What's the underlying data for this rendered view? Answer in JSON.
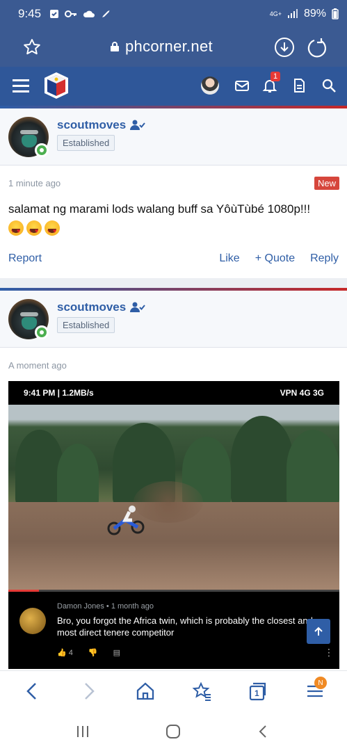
{
  "status": {
    "time": "9:45",
    "network": "4G+",
    "battery": "89%"
  },
  "browser": {
    "url": "phcorner.net"
  },
  "nav": {
    "notification_count": "1"
  },
  "posts": [
    {
      "username": "scoutmoves",
      "user_title": "Established",
      "time": "1 minute ago",
      "badge": "New",
      "message": "salamat ng marami lods walang buff sa YôùTùbé 1080p!!!",
      "actions": {
        "report": "Report",
        "like": "Like",
        "quote": "Quote",
        "reply": "Reply"
      }
    },
    {
      "username": "scoutmoves",
      "user_title": "Established",
      "time": "A moment ago"
    }
  ],
  "screenshot": {
    "status_left": "9:41 PM | 1.2MB/s",
    "status_right": "VPN 4G 3G",
    "comment_author": "Damon Jones",
    "comment_time": "1 month ago",
    "comment_text": "Bro, you forgot the Africa twin, which is probably the closest and most direct tenere competitor",
    "likes": "4"
  },
  "bottom_nav": {
    "tabs_count": "1",
    "menu_badge": "N"
  }
}
